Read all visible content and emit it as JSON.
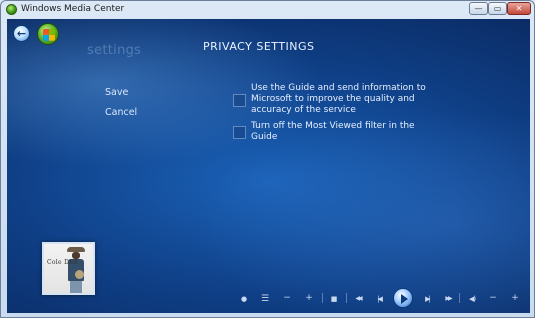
{
  "window": {
    "title": "Windows Media Center",
    "controls": {
      "minimize": "—",
      "maximize": "▭",
      "close": "✕"
    }
  },
  "nav": {
    "back_icon": "back-arrow-icon",
    "start_icon": "windows-start-orb-icon"
  },
  "page": {
    "section_label": "settings",
    "title": "PRIVACY SETTINGS"
  },
  "commands": {
    "save_label": "Save",
    "cancel_label": "Cancel"
  },
  "options": [
    {
      "label": "Use the Guide and send information to Microsoft to improve the quality and accuracy of the service",
      "checked": false
    },
    {
      "label": "Turn off the Most Viewed filter in the Guide",
      "checked": false
    }
  ],
  "now_playing": {
    "cover_text": "Cole DEE"
  },
  "transport": {
    "glyphs": {
      "dot": "●",
      "list": "☰",
      "minus": "−",
      "plus": "+",
      "stop": "■",
      "rewind": "◀◀",
      "previous": "|◀",
      "next": "▶|",
      "fast_forward": "▶▶",
      "mute": "◀)",
      "vol_down": "−",
      "vol_up": "+"
    }
  }
}
